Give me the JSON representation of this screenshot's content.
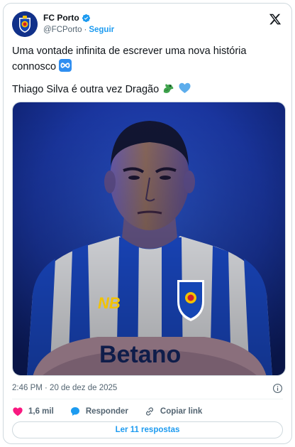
{
  "author": {
    "display_name": "FC Porto",
    "handle": "@FCPorto",
    "separator": "·",
    "follow_label": "Seguir",
    "verified_color": "#1d9bf0",
    "avatar_icon": "fc-porto-crest"
  },
  "tweet": {
    "line1": "Uma vontade infinita de escrever uma nova história connosco",
    "line1_emoji": "infinity",
    "line2": "Thiago Silva é outra vez Dragão",
    "line2_emojis": [
      "dragon",
      "blue-heart"
    ]
  },
  "media": {
    "type": "photo",
    "jersey_sponsor": "Betano",
    "background_color": "#1e3ea6"
  },
  "meta": {
    "timestamp": "2:46 PM · 20 de dez de 2025"
  },
  "actions": {
    "likes_count": "1,6 mil",
    "reply_label": "Responder",
    "copy_link_label": "Copiar link"
  },
  "footer": {
    "read_replies_label": "Ler 11 respostas"
  },
  "colors": {
    "accent": "#1d9bf0",
    "like": "#f91880",
    "text_secondary": "#536471"
  }
}
